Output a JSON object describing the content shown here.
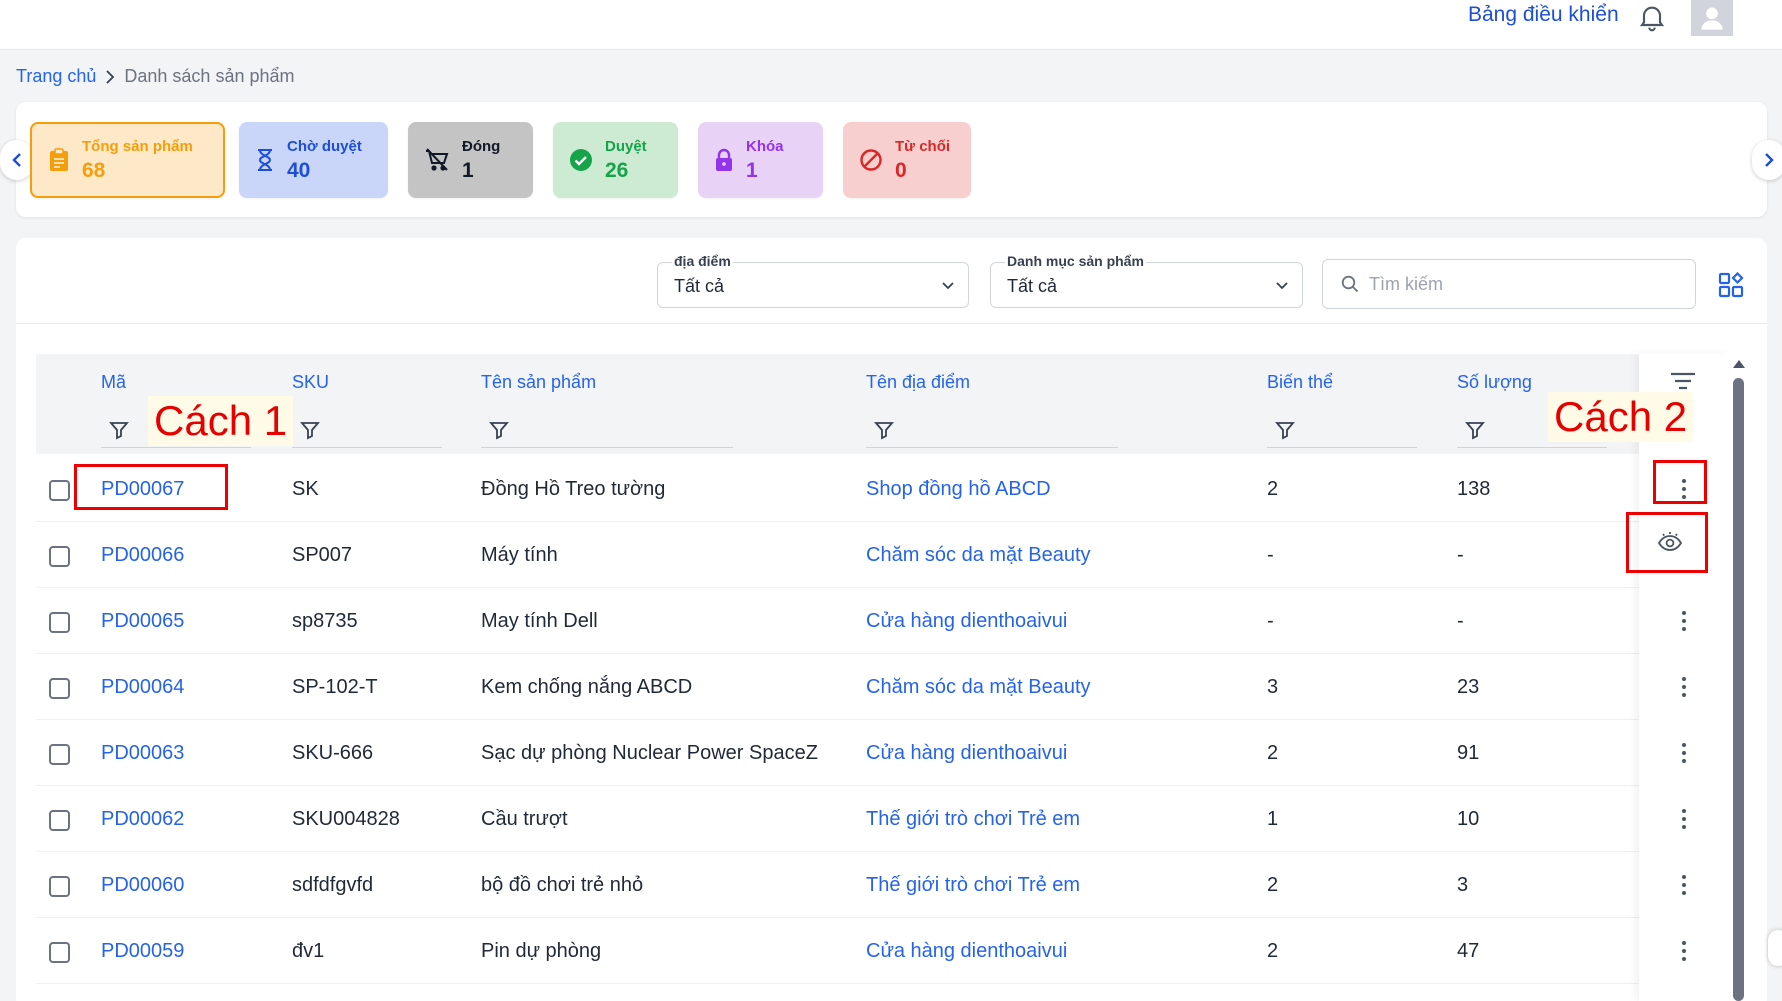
{
  "header": {
    "dashboard_label": "Bảng điều khiển"
  },
  "breadcrumb": {
    "home": "Trang chủ",
    "current": "Danh sách sản phẩm"
  },
  "stats": [
    {
      "label": "Tổng sản phẩm",
      "value": "68",
      "icon": "clipboard-icon",
      "color": "#f59e0b"
    },
    {
      "label": "Chờ duyệt",
      "value": "40",
      "icon": "hourglass-icon",
      "color": "#1d4ed8"
    },
    {
      "label": "Đóng",
      "value": "1",
      "icon": "cart-off-icon",
      "color": "#111827"
    },
    {
      "label": "Duyệt",
      "value": "26",
      "icon": "check-circle-icon",
      "color": "#16a34a"
    },
    {
      "label": "Khóa",
      "value": "1",
      "icon": "lock-icon",
      "color": "#9333ea"
    },
    {
      "label": "Từ chối",
      "value": "0",
      "icon": "ban-icon",
      "color": "#dc2626"
    }
  ],
  "filters": {
    "location": {
      "label": "địa điểm",
      "value": "Tất cả"
    },
    "category": {
      "label": "Danh mục sản phẩm",
      "value": "Tất cả"
    },
    "search_placeholder": "Tìm kiếm"
  },
  "table": {
    "columns": [
      "Mã",
      "SKU",
      "Tên sản phẩm",
      "Tên địa điểm",
      "Biến thể",
      "Số lượng"
    ],
    "rows": [
      {
        "code": "PD00067",
        "sku": "SK",
        "name": "Đồng Hồ Treo tường",
        "location": "Shop đồng hồ ABCD",
        "variants": "2",
        "qty": "138"
      },
      {
        "code": "PD00066",
        "sku": "SP007",
        "name": "Máy tính",
        "location": "Chăm sóc da mặt Beauty",
        "variants": "-",
        "qty": "-"
      },
      {
        "code": "PD00065",
        "sku": "sp8735",
        "name": "May tính Dell",
        "location": "Cửa hàng dienthoaivui",
        "variants": "-",
        "qty": "-"
      },
      {
        "code": "PD00064",
        "sku": "SP-102-T",
        "name": "Kem chống nắng ABCD",
        "location": "Chăm sóc da mặt Beauty",
        "variants": "3",
        "qty": "23"
      },
      {
        "code": "PD00063",
        "sku": "SKU-666",
        "name": "Sạc dự phòng Nuclear Power SpaceZ",
        "location": "Cửa hàng dienthoaivui",
        "variants": "2",
        "qty": "91"
      },
      {
        "code": "PD00062",
        "sku": "SKU004828",
        "name": "Cầu trượt",
        "location": "Thế giới trò chơi Trẻ em",
        "variants": "1",
        "qty": "10"
      },
      {
        "code": "PD00060",
        "sku": "sdfdfgvfd",
        "name": "bộ đồ chơi trẻ nhỏ",
        "location": "Thế giới trò chơi Trẻ em",
        "variants": "2",
        "qty": "3"
      },
      {
        "code": "PD00059",
        "sku": "đv1",
        "name": "Pin dự phòng",
        "location": "Cửa hàng dienthoaivui",
        "variants": "2",
        "qty": "47"
      }
    ]
  },
  "annotations": {
    "label1": "Cách 1",
    "label2": "Cách 2",
    "color": "#ef0000"
  }
}
